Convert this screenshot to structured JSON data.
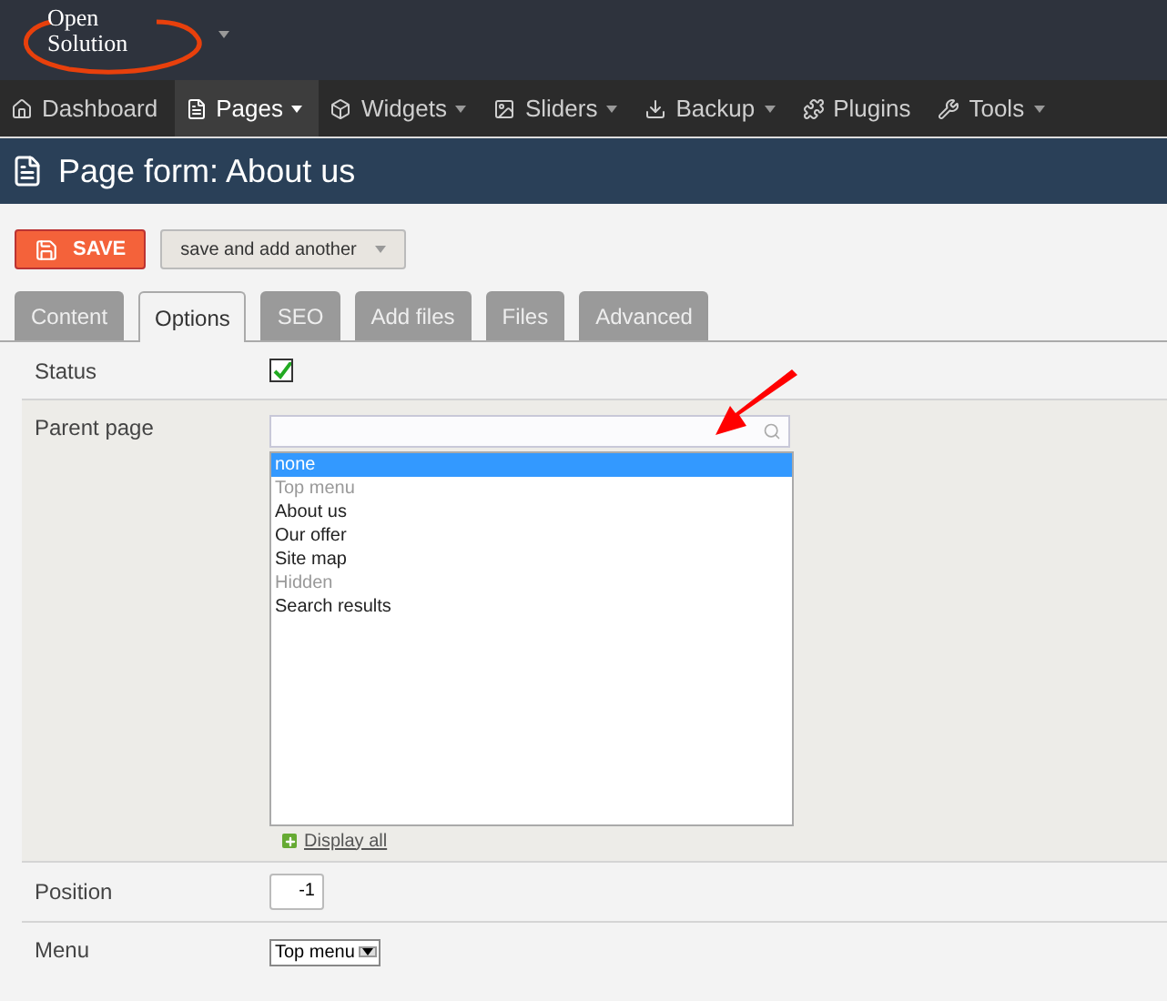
{
  "logo": {
    "lines": [
      "Open",
      "Solution"
    ]
  },
  "nav": [
    {
      "label": "Dashboard",
      "dropdown": false,
      "selected": false
    },
    {
      "label": "Pages",
      "dropdown": true,
      "selected": true
    },
    {
      "label": "Widgets",
      "dropdown": true,
      "selected": false
    },
    {
      "label": "Sliders",
      "dropdown": true,
      "selected": false
    },
    {
      "label": "Backup",
      "dropdown": true,
      "selected": false
    },
    {
      "label": "Plugins",
      "dropdown": false,
      "selected": false
    },
    {
      "label": "Tools",
      "dropdown": true,
      "selected": false
    }
  ],
  "page_title": "Page form: About us",
  "actions": {
    "save": "SAVE",
    "save_another": "save and add another"
  },
  "tabs": [
    {
      "label": "Content",
      "selected": false
    },
    {
      "label": "Options",
      "selected": true
    },
    {
      "label": "SEO",
      "selected": false
    },
    {
      "label": "Add files",
      "selected": false
    },
    {
      "label": "Files",
      "selected": false
    },
    {
      "label": "Advanced",
      "selected": false
    }
  ],
  "form": {
    "status": {
      "label": "Status",
      "checked": true
    },
    "parent_page": {
      "label": "Parent page",
      "options": [
        {
          "label": "none",
          "kind": "option",
          "selected": true
        },
        {
          "label": "Top menu",
          "kind": "group",
          "selected": false
        },
        {
          "label": "About us",
          "kind": "option",
          "selected": false
        },
        {
          "label": "Our offer",
          "kind": "option",
          "selected": false
        },
        {
          "label": "Site map",
          "kind": "option",
          "selected": false
        },
        {
          "label": "Hidden",
          "kind": "group",
          "selected": false
        },
        {
          "label": "Search results",
          "kind": "option",
          "selected": false
        }
      ],
      "display_all": "Display all"
    },
    "position": {
      "label": "Position",
      "value": "-1"
    },
    "menu": {
      "label": "Menu",
      "value": "Top menu"
    }
  }
}
